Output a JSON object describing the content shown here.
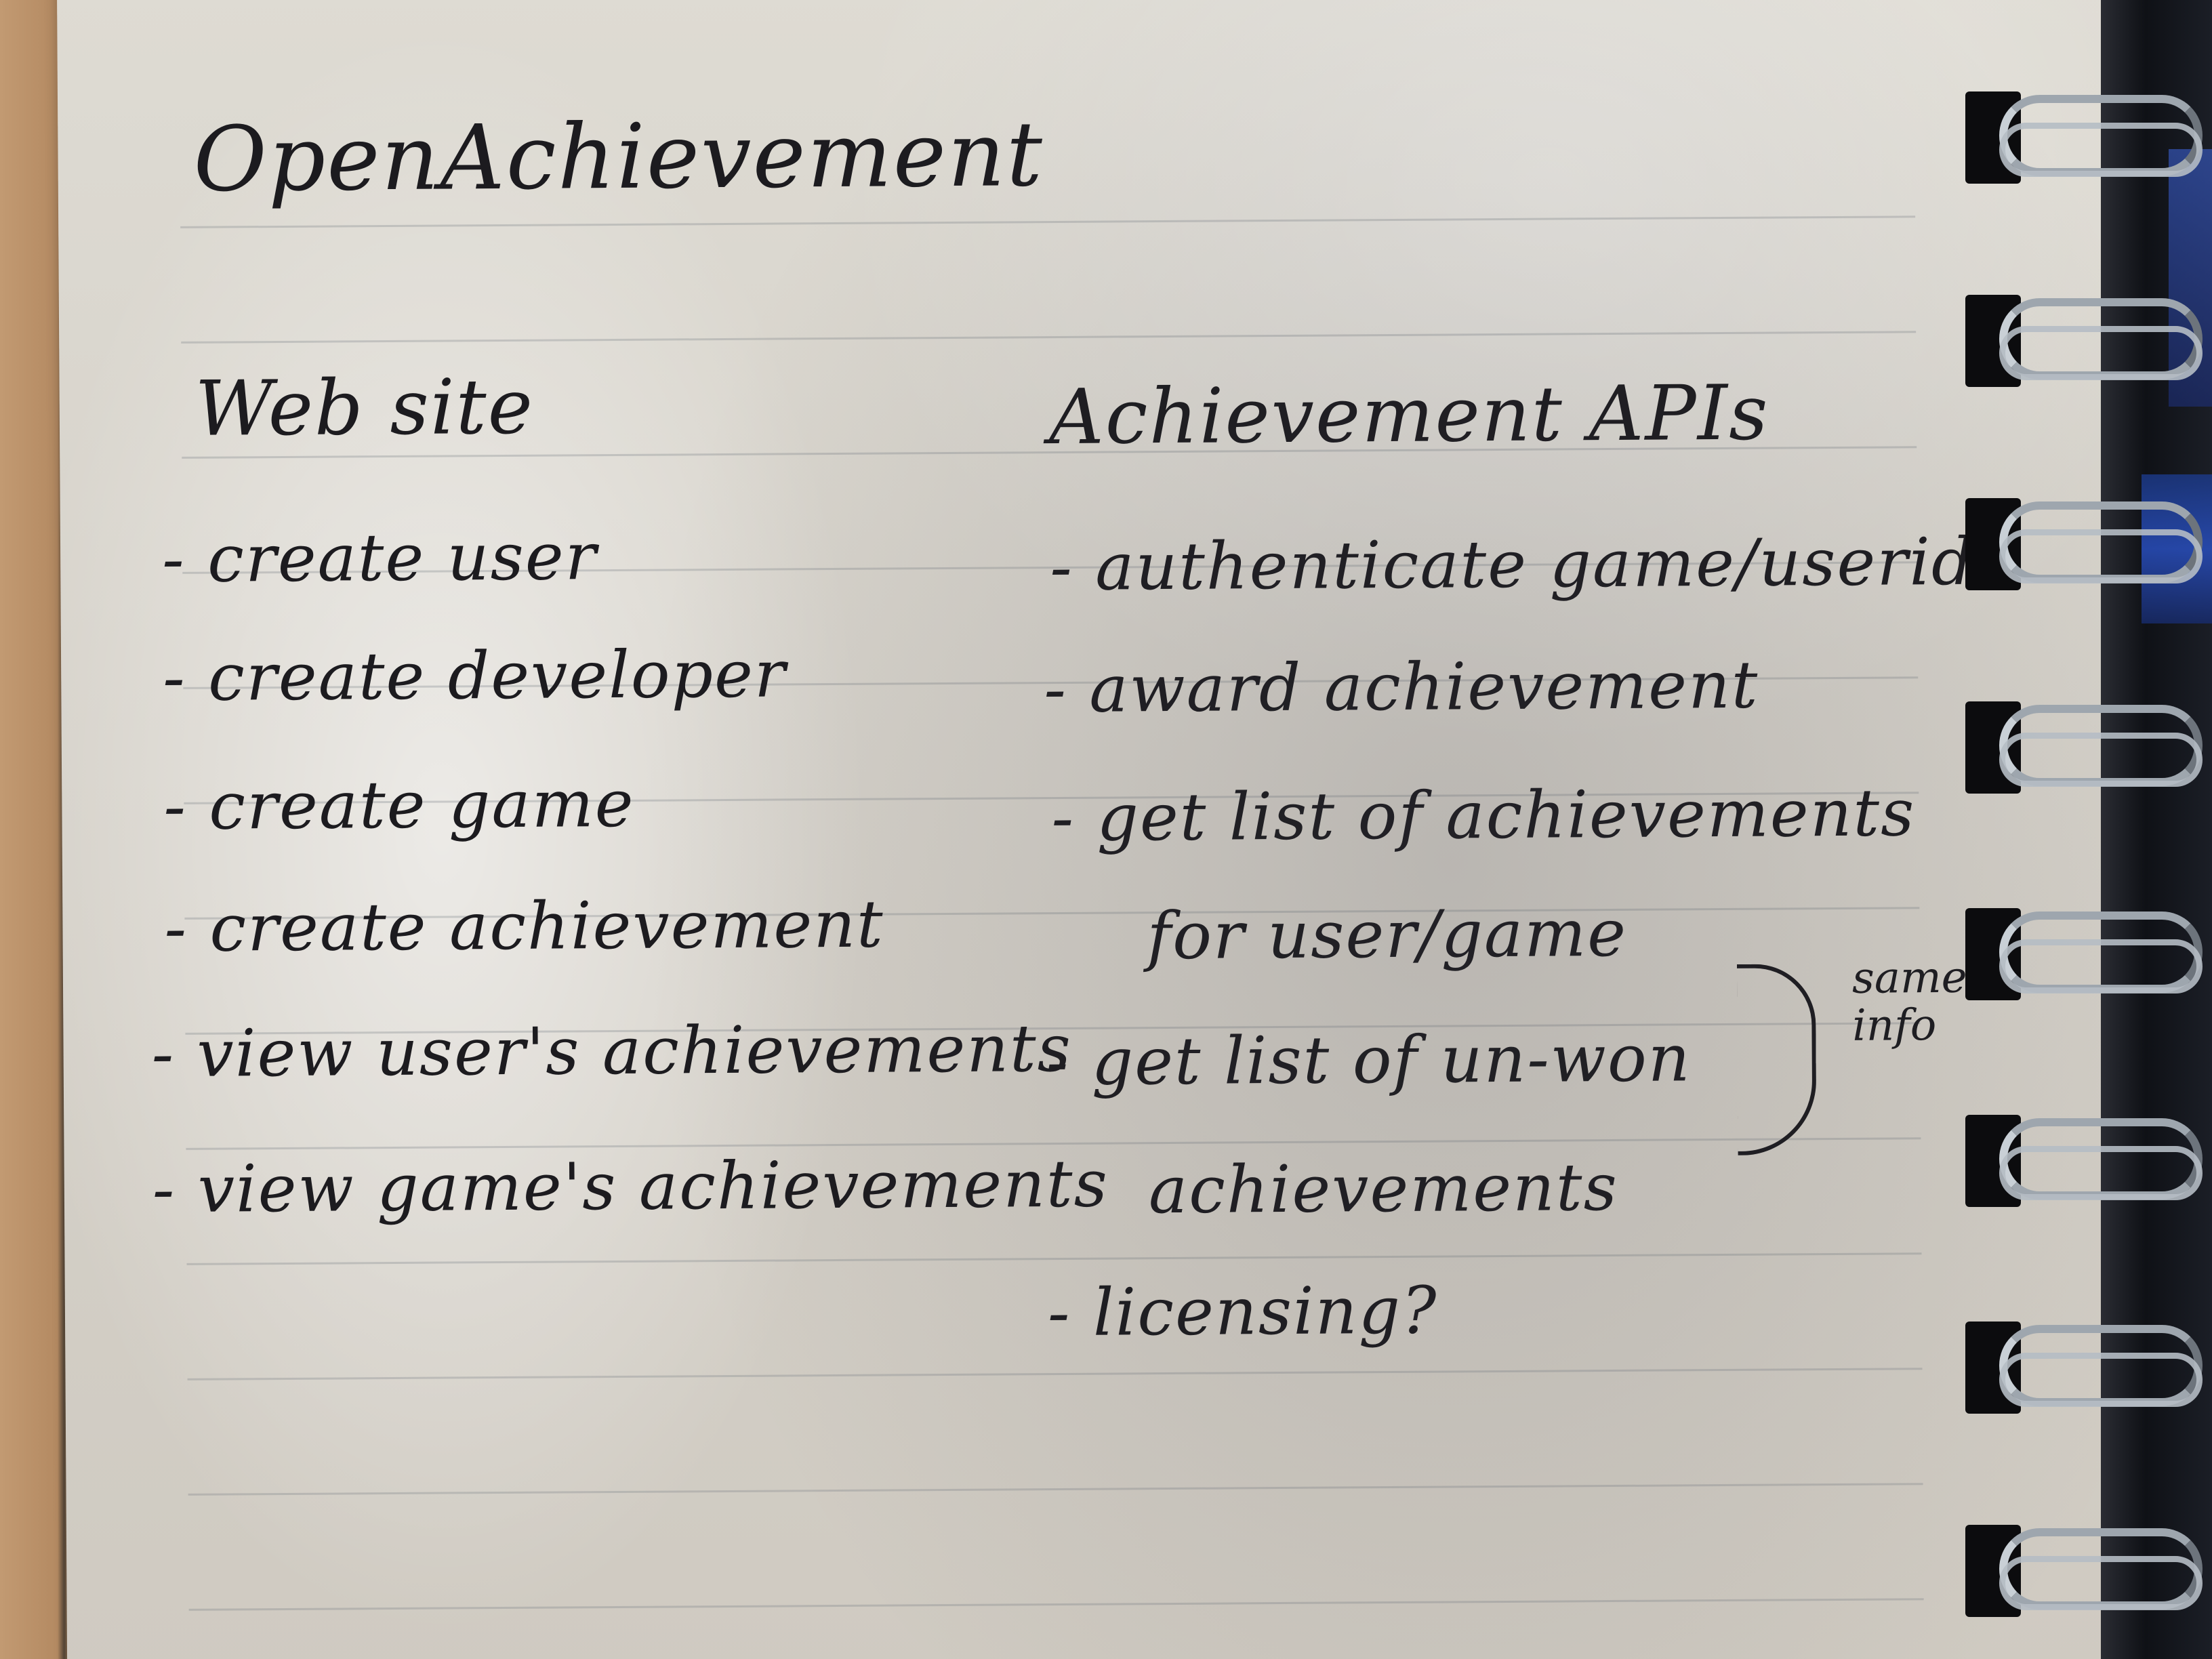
{
  "notebook": {
    "title": "OpenAchievement",
    "left_column": {
      "heading": "Web site",
      "items": [
        "- create user",
        "- create developer",
        "- create game",
        "- create achievement",
        "- view user's achievements",
        "- view game's achievements"
      ]
    },
    "right_column": {
      "heading": "Achievement APIs",
      "items": [
        "- authenticate game/userid",
        "- award achievement",
        "- get list of achievements",
        "for user/game",
        "- get list of un-won",
        "achievements",
        "- licensing?"
      ],
      "side_note": "same info"
    }
  },
  "colors": {
    "ink": "#1c1b1f",
    "paper": "#d8d4cc",
    "desk": "#b98f66",
    "spiral": "#9ea6ae"
  }
}
